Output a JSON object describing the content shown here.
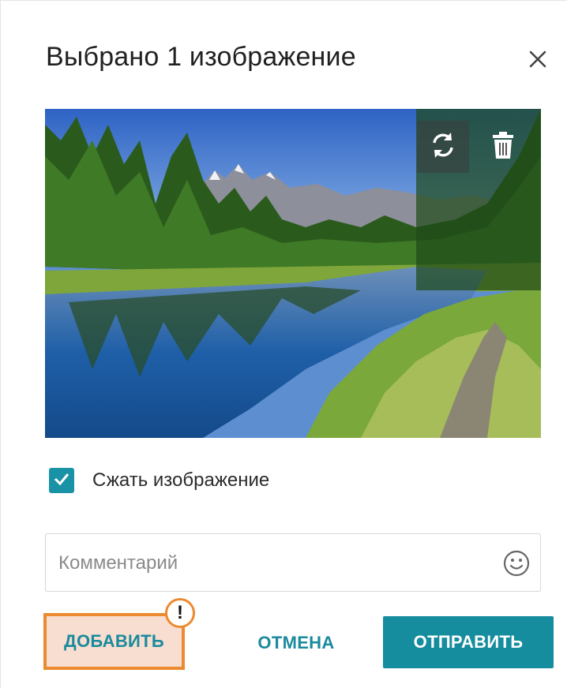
{
  "dialog": {
    "title": "Выбрано 1 изображение",
    "close_icon": "close-icon"
  },
  "preview": {
    "rotate_icon": "rotate-icon",
    "delete_icon": "trash-icon"
  },
  "compress": {
    "label": "Сжать изображение",
    "checked": true,
    "color": "#1a92a6"
  },
  "comment": {
    "placeholder": "Комментарий",
    "value": "",
    "emoji_icon": "emoji-icon"
  },
  "actions": {
    "add_label": "ДОБАВИТЬ",
    "warning_badge": "!",
    "cancel_label": "ОТМЕНА",
    "send_label": "ОТПРАВИТЬ",
    "accent_color": "#168c9f",
    "highlight_color": "#ec8a2f"
  }
}
